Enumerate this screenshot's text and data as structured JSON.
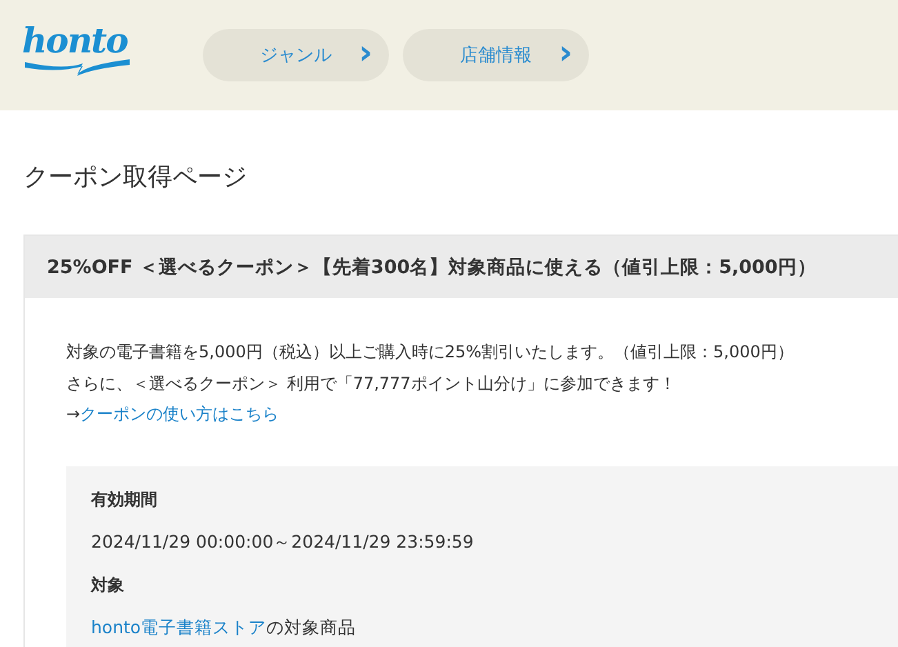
{
  "header": {
    "logo": "honto",
    "nav_buttons": [
      {
        "label": "ジャンル",
        "chevron": "›"
      },
      {
        "label": "店舗情報",
        "chevron": "›"
      }
    ]
  },
  "page_title": "クーポン取得ページ",
  "coupon": {
    "title": "25%OFF ＜選べるクーポン＞【先着300名】対象商品に使える（値引上限：5,000円）",
    "description": [
      "対象の電子書籍を5,000円（税込）以上ご購入時に25%割引いたします。（値引上限：5,000円）",
      "さらに、＜選べるクーポン＞ 利用で「77,777ポイント山分け」に参加できます！"
    ],
    "usage_link": {
      "prefix": "→",
      "text": "クーポンの使い方はこちら"
    },
    "details": {
      "period_label": "有効期間",
      "period": "2024/11/29 00:00:00～2024/11/29 23:59:59",
      "target_label": "対象",
      "target_link": "honto電子書籍ストア",
      "target_suffix": "の対象商品"
    }
  }
}
